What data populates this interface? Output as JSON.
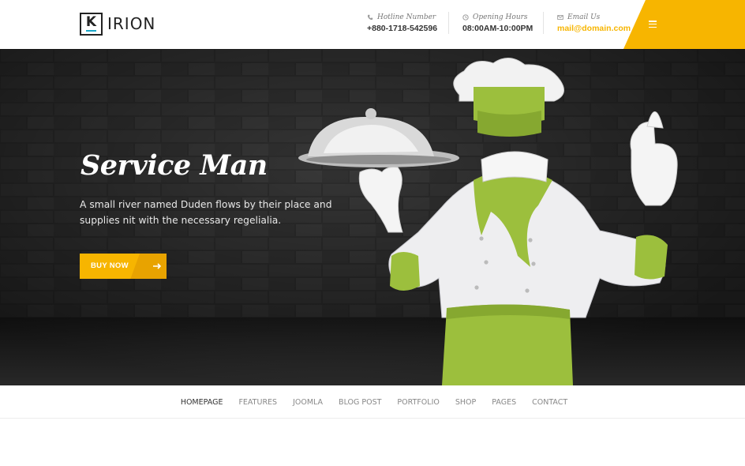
{
  "brand": {
    "logo_letter": "K",
    "name": "IRION"
  },
  "contacts": [
    {
      "icon": "phone-icon",
      "label": "Hotline Number",
      "value": "+880-1718-542596"
    },
    {
      "icon": "clock-icon",
      "label": "Opening Hours",
      "value": "08:00AM-10:00PM"
    },
    {
      "icon": "mail-icon",
      "label": "Email Us",
      "value": "mail@domain.com"
    }
  ],
  "colors": {
    "accent": "#f7b500",
    "accent_dark": "#e8a300",
    "logo_bar": "#1aa6c8",
    "apron_green": "#9cbf3d"
  },
  "hero": {
    "title": "Service Man",
    "text": "A small river named Duden flows by their place and supplies nit with the necessary regelialia.",
    "button_label": "BUY NOW",
    "button_icon": "arrow-right-icon"
  },
  "nav": {
    "items": [
      "HOMEPAGE",
      "FEATURES",
      "JOOMLA",
      "BLOG POST",
      "PORTFOLIO",
      "SHOP",
      "PAGES",
      "CONTACT"
    ],
    "active_index": 0
  }
}
